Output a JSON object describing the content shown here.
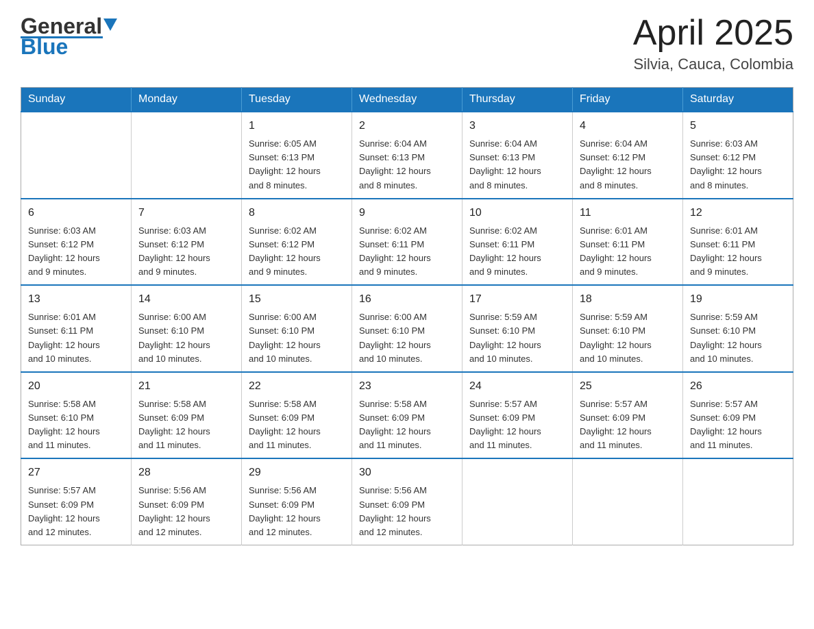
{
  "header": {
    "logo_general": "General",
    "logo_blue": "Blue",
    "month_title": "April 2025",
    "location": "Silvia, Cauca, Colombia"
  },
  "days_of_week": [
    "Sunday",
    "Monday",
    "Tuesday",
    "Wednesday",
    "Thursday",
    "Friday",
    "Saturday"
  ],
  "weeks": [
    [
      {
        "day": "",
        "info": ""
      },
      {
        "day": "",
        "info": ""
      },
      {
        "day": "1",
        "info": "Sunrise: 6:05 AM\nSunset: 6:13 PM\nDaylight: 12 hours\nand 8 minutes."
      },
      {
        "day": "2",
        "info": "Sunrise: 6:04 AM\nSunset: 6:13 PM\nDaylight: 12 hours\nand 8 minutes."
      },
      {
        "day": "3",
        "info": "Sunrise: 6:04 AM\nSunset: 6:13 PM\nDaylight: 12 hours\nand 8 minutes."
      },
      {
        "day": "4",
        "info": "Sunrise: 6:04 AM\nSunset: 6:12 PM\nDaylight: 12 hours\nand 8 minutes."
      },
      {
        "day": "5",
        "info": "Sunrise: 6:03 AM\nSunset: 6:12 PM\nDaylight: 12 hours\nand 8 minutes."
      }
    ],
    [
      {
        "day": "6",
        "info": "Sunrise: 6:03 AM\nSunset: 6:12 PM\nDaylight: 12 hours\nand 9 minutes."
      },
      {
        "day": "7",
        "info": "Sunrise: 6:03 AM\nSunset: 6:12 PM\nDaylight: 12 hours\nand 9 minutes."
      },
      {
        "day": "8",
        "info": "Sunrise: 6:02 AM\nSunset: 6:12 PM\nDaylight: 12 hours\nand 9 minutes."
      },
      {
        "day": "9",
        "info": "Sunrise: 6:02 AM\nSunset: 6:11 PM\nDaylight: 12 hours\nand 9 minutes."
      },
      {
        "day": "10",
        "info": "Sunrise: 6:02 AM\nSunset: 6:11 PM\nDaylight: 12 hours\nand 9 minutes."
      },
      {
        "day": "11",
        "info": "Sunrise: 6:01 AM\nSunset: 6:11 PM\nDaylight: 12 hours\nand 9 minutes."
      },
      {
        "day": "12",
        "info": "Sunrise: 6:01 AM\nSunset: 6:11 PM\nDaylight: 12 hours\nand 9 minutes."
      }
    ],
    [
      {
        "day": "13",
        "info": "Sunrise: 6:01 AM\nSunset: 6:11 PM\nDaylight: 12 hours\nand 10 minutes."
      },
      {
        "day": "14",
        "info": "Sunrise: 6:00 AM\nSunset: 6:10 PM\nDaylight: 12 hours\nand 10 minutes."
      },
      {
        "day": "15",
        "info": "Sunrise: 6:00 AM\nSunset: 6:10 PM\nDaylight: 12 hours\nand 10 minutes."
      },
      {
        "day": "16",
        "info": "Sunrise: 6:00 AM\nSunset: 6:10 PM\nDaylight: 12 hours\nand 10 minutes."
      },
      {
        "day": "17",
        "info": "Sunrise: 5:59 AM\nSunset: 6:10 PM\nDaylight: 12 hours\nand 10 minutes."
      },
      {
        "day": "18",
        "info": "Sunrise: 5:59 AM\nSunset: 6:10 PM\nDaylight: 12 hours\nand 10 minutes."
      },
      {
        "day": "19",
        "info": "Sunrise: 5:59 AM\nSunset: 6:10 PM\nDaylight: 12 hours\nand 10 minutes."
      }
    ],
    [
      {
        "day": "20",
        "info": "Sunrise: 5:58 AM\nSunset: 6:10 PM\nDaylight: 12 hours\nand 11 minutes."
      },
      {
        "day": "21",
        "info": "Sunrise: 5:58 AM\nSunset: 6:09 PM\nDaylight: 12 hours\nand 11 minutes."
      },
      {
        "day": "22",
        "info": "Sunrise: 5:58 AM\nSunset: 6:09 PM\nDaylight: 12 hours\nand 11 minutes."
      },
      {
        "day": "23",
        "info": "Sunrise: 5:58 AM\nSunset: 6:09 PM\nDaylight: 12 hours\nand 11 minutes."
      },
      {
        "day": "24",
        "info": "Sunrise: 5:57 AM\nSunset: 6:09 PM\nDaylight: 12 hours\nand 11 minutes."
      },
      {
        "day": "25",
        "info": "Sunrise: 5:57 AM\nSunset: 6:09 PM\nDaylight: 12 hours\nand 11 minutes."
      },
      {
        "day": "26",
        "info": "Sunrise: 5:57 AM\nSunset: 6:09 PM\nDaylight: 12 hours\nand 11 minutes."
      }
    ],
    [
      {
        "day": "27",
        "info": "Sunrise: 5:57 AM\nSunset: 6:09 PM\nDaylight: 12 hours\nand 12 minutes."
      },
      {
        "day": "28",
        "info": "Sunrise: 5:56 AM\nSunset: 6:09 PM\nDaylight: 12 hours\nand 12 minutes."
      },
      {
        "day": "29",
        "info": "Sunrise: 5:56 AM\nSunset: 6:09 PM\nDaylight: 12 hours\nand 12 minutes."
      },
      {
        "day": "30",
        "info": "Sunrise: 5:56 AM\nSunset: 6:09 PM\nDaylight: 12 hours\nand 12 minutes."
      },
      {
        "day": "",
        "info": ""
      },
      {
        "day": "",
        "info": ""
      },
      {
        "day": "",
        "info": ""
      }
    ]
  ]
}
